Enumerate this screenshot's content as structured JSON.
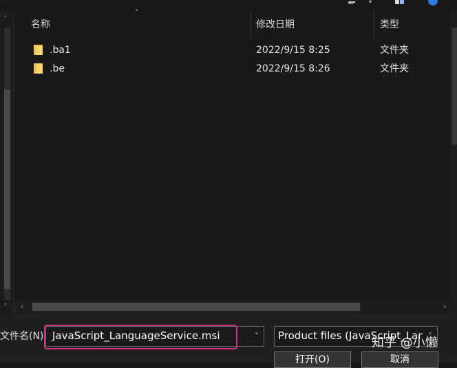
{
  "toolbar": {
    "icons": [
      "view-options-icon",
      "pane-icon",
      "help-icon"
    ]
  },
  "columns": {
    "name": "名称",
    "date_modified": "修改日期",
    "type": "类型"
  },
  "files": [
    {
      "name": ".ba1",
      "date": "2022/9/15 8:25",
      "type": "文件夹",
      "icon": "folder-icon"
    },
    {
      "name": ".be",
      "date": "2022/9/15 8:26",
      "type": "文件夹",
      "icon": "folder-icon"
    }
  ],
  "filename": {
    "label": "文件名(N):",
    "value": "JavaScript_LanguageService.msi"
  },
  "filter": {
    "selected": "Product files (JavaScript_Lan"
  },
  "buttons": {
    "open": "打开(O)",
    "cancel": "取消"
  },
  "watermark": "知乎 @小懒",
  "colors": {
    "highlight": "#d0307f",
    "folder": "#f2c04f",
    "background": "#191919"
  }
}
